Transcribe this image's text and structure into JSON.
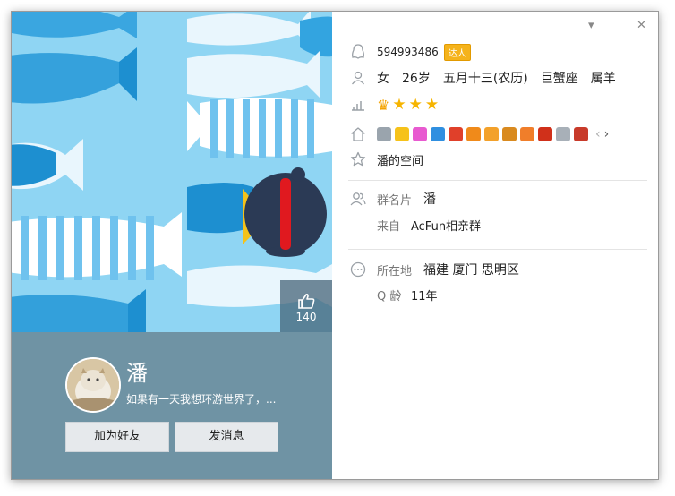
{
  "profile": {
    "likes": "140",
    "nickname": "潘",
    "signature": "如果有一天我想环游世界了，...",
    "add_friend_label": "加为好友",
    "send_message_label": "发消息"
  },
  "window": {
    "minimize_label": "▾",
    "close_label": "✕"
  },
  "info": {
    "qq_number": "594993486",
    "vip_badge": "达人",
    "gender": "女",
    "age": "26岁",
    "birthday": "五月十三(农历)",
    "zodiac": "巨蟹座",
    "chinese_zodiac": "属羊",
    "level_icons": [
      "crown-icon",
      "star-icon",
      "star-icon",
      "star-icon"
    ],
    "service_badges": [
      "diamond-badge",
      "star-badge",
      "app-badge",
      "photo-badge",
      "pet-badge",
      "game-badge",
      "book-badge",
      "tiger-badge",
      "monkey-badge",
      "fire-badge",
      "gem-badge",
      "avatar-badge"
    ],
    "space_label": "潘的空间",
    "group_card_label": "群名片",
    "group_card_value": "潘",
    "from_label": "来自",
    "from_value": "AcFun相亲群",
    "location_label": "所在地",
    "location_value": "福建 厦门 思明区",
    "qage_label": "Q 龄",
    "qage_value": "11年"
  },
  "colors": {
    "banner_bg": "#8fd5f3",
    "card_bg": "#6f93a4",
    "fish_dark": "#1d8fd0",
    "penguin": "#2b3a55",
    "scarf": "#e0191f"
  }
}
